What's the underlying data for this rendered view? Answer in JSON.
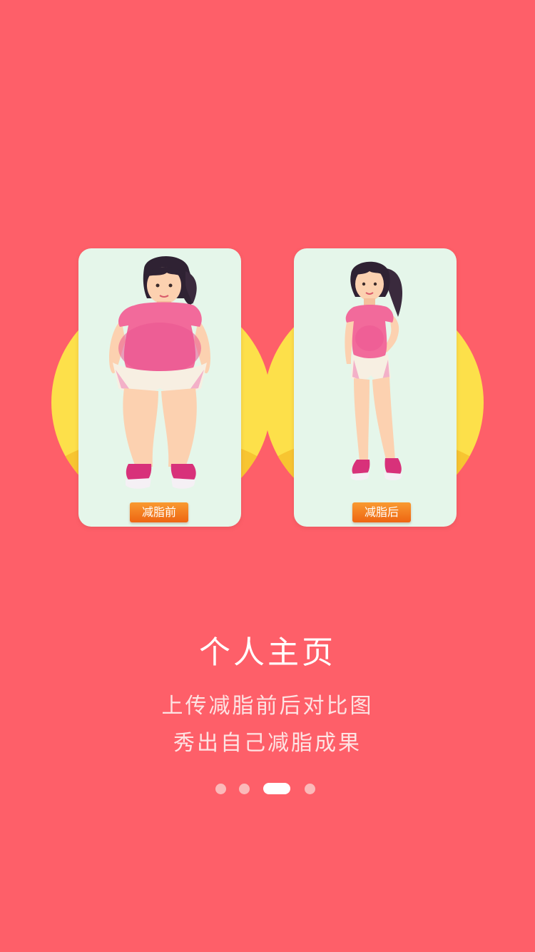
{
  "onboarding": {
    "cards": [
      {
        "label": "减脂前",
        "figure": "plus-size-girl-illustration"
      },
      {
        "label": "减脂后",
        "figure": "slim-girl-illustration"
      }
    ],
    "title": "个人主页",
    "description_lines": [
      "上传减脂前后对比图",
      "秀出自己减脂成果"
    ],
    "pager": {
      "total": 4,
      "active_index": 2
    }
  },
  "colors": {
    "background": "#fe5f69",
    "circle": "#fde04a",
    "card": "#e5f6ea",
    "badge": "#f47a1f",
    "shirt": "#f26a9b",
    "shorts": "#f7efe2",
    "shoes": "#d8317a",
    "hair": "#2f2233",
    "skin": "#fcd1b0"
  }
}
